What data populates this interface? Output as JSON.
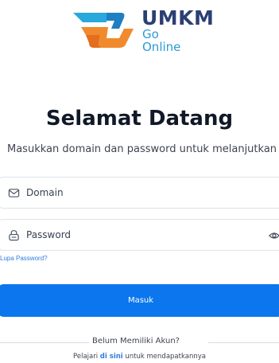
{
  "logo": {
    "brand": "UMKM",
    "line1": "Go",
    "line2": "Online"
  },
  "heading": {
    "title": "Selamat Datang",
    "subtitle": "Masukkan domain dan password untuk melanjutkan"
  },
  "form": {
    "domain": {
      "placeholder": "Domain",
      "value": "",
      "icon": "mail-icon"
    },
    "password": {
      "placeholder": "Password",
      "value": "",
      "icon": "lock-icon",
      "toggle_icon": "eye-icon"
    },
    "forgot_label": "Lupa Password?",
    "submit_label": "Masuk"
  },
  "footer": {
    "divider_label": "Belum Memiliki Akun?",
    "register_prefix": "Pelajari ",
    "register_link": "di sini",
    "register_suffix": " untuk mendapatkannya"
  },
  "colors": {
    "primary": "#0b76ee",
    "link": "#2f7de0",
    "logo_navy": "#2c3f74",
    "logo_blue": "#2a9bd6",
    "logo_orange": "#f08a2c"
  }
}
